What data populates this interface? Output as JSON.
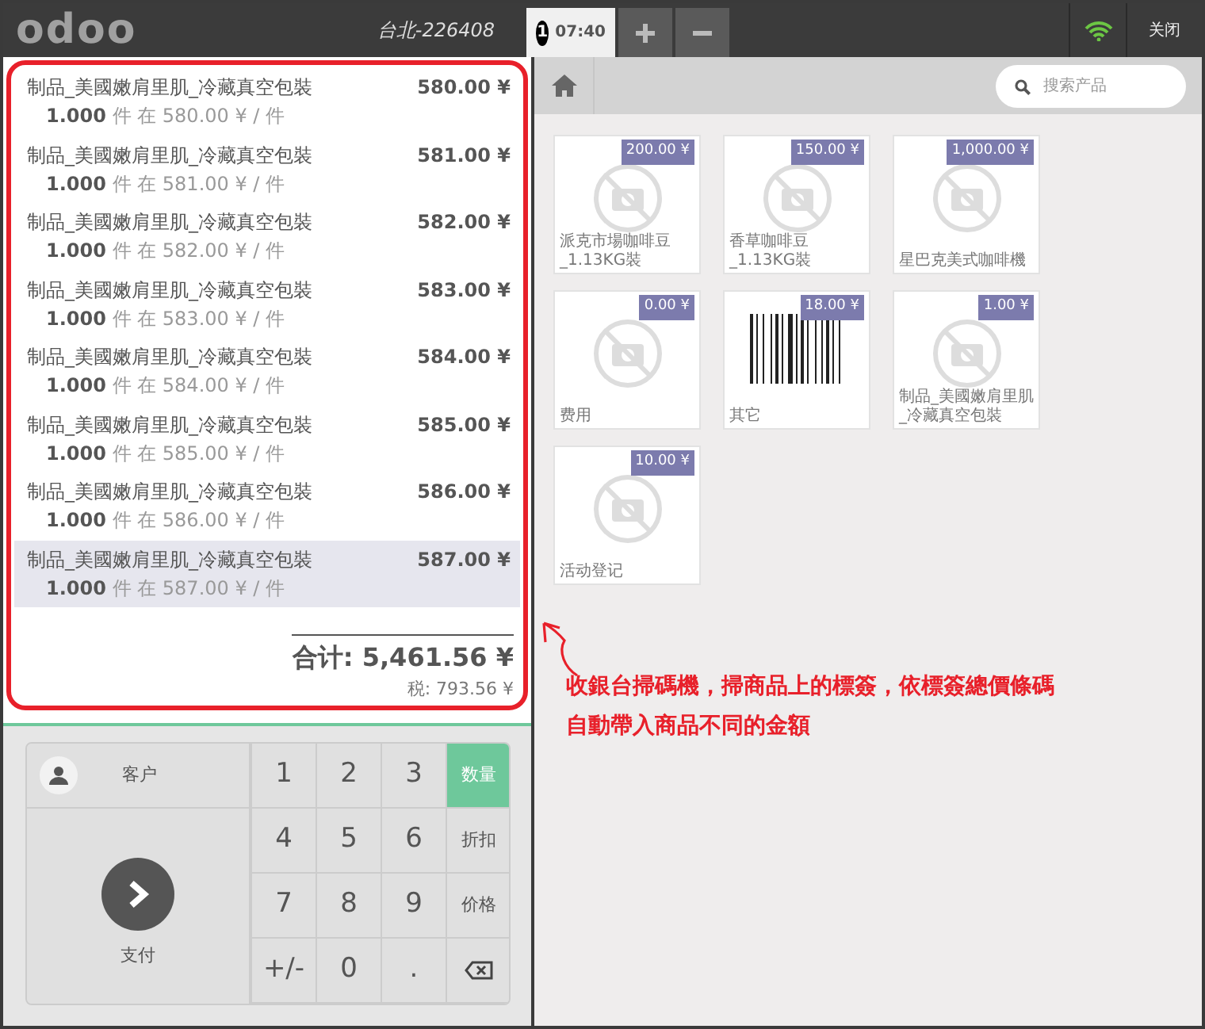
{
  "header": {
    "logo": "odoo",
    "shop": "台北-226408",
    "order_tabs": [
      {
        "number": "1",
        "time": "07:40",
        "selected": true
      }
    ],
    "close": "关闭"
  },
  "order_lines": [
    {
      "name": "制品_美國嫩肩里肌_冷藏真空包裝",
      "price": "580.00 ¥",
      "detail": "**1.000** 件 在 580.00 ¥ / 件",
      "selected": false
    },
    {
      "name": "制品_美國嫩肩里肌_冷藏真空包裝",
      "price": "581.00 ¥",
      "detail": "**1.000** 件 在 581.00 ¥ / 件",
      "selected": false
    },
    {
      "name": "制品_美國嫩肩里肌_冷藏真空包裝",
      "price": "582.00 ¥",
      "detail": "**1.000** 件 在 582.00 ¥ / 件",
      "selected": false
    },
    {
      "name": "制品_美國嫩肩里肌_冷藏真空包裝",
      "price": "583.00 ¥",
      "detail": "**1.000** 件 在 583.00 ¥ / 件",
      "selected": false
    },
    {
      "name": "制品_美國嫩肩里肌_冷藏真空包裝",
      "price": "584.00 ¥",
      "detail": "**1.000** 件 在 584.00 ¥ / 件",
      "selected": false
    },
    {
      "name": "制品_美國嫩肩里肌_冷藏真空包裝",
      "price": "585.00 ¥",
      "detail": "**1.000** 件 在 585.00 ¥ / 件",
      "selected": false
    },
    {
      "name": "制品_美國嫩肩里肌_冷藏真空包裝",
      "price": "586.00 ¥",
      "detail": "**1.000** 件 在 586.00 ¥ / 件",
      "selected": false
    },
    {
      "name": "制品_美國嫩肩里肌_冷藏真空包裝",
      "price": "587.00 ¥",
      "detail": "**1.000** 件 在 587.00 ¥ / 件",
      "selected": true
    }
  ],
  "total": "合计: 5,461.56 ¥",
  "tax": "税: 793.56 ¥",
  "numpad": {
    "customer": "客户",
    "pay": "支付",
    "keys": [
      {
        "kind": "digit",
        "label": "1"
      },
      {
        "kind": "digit",
        "label": "2"
      },
      {
        "kind": "digit",
        "label": "3"
      },
      {
        "kind": "mode",
        "label": "数量",
        "selected": true
      },
      {
        "kind": "digit",
        "label": "4"
      },
      {
        "kind": "digit",
        "label": "5"
      },
      {
        "kind": "digit",
        "label": "6"
      },
      {
        "kind": "mode",
        "label": "折扣",
        "selected": false
      },
      {
        "kind": "digit",
        "label": "7"
      },
      {
        "kind": "digit",
        "label": "8"
      },
      {
        "kind": "digit",
        "label": "9"
      },
      {
        "kind": "mode",
        "label": "价格",
        "selected": false
      },
      {
        "kind": "digit",
        "label": "+/-"
      },
      {
        "kind": "digit",
        "label": "0"
      },
      {
        "kind": "digit",
        "label": "."
      },
      {
        "kind": "backspace"
      }
    ]
  },
  "search": {
    "placeholder": "搜索产品"
  },
  "products": [
    {
      "name": "派克市場咖啡豆_1.13KG裝",
      "price": "200.00 ¥",
      "kind": "placeholder"
    },
    {
      "name": "香草咖啡豆_1.13KG裝",
      "price": "150.00 ¥",
      "kind": "placeholder"
    },
    {
      "name": "星巴克美式咖啡機",
      "price": "1,000.00 ¥",
      "kind": "placeholder"
    },
    {
      "name": "费用",
      "price": "0.00 ¥",
      "kind": "placeholder"
    },
    {
      "name": "其它",
      "price": "18.00 ¥",
      "kind": "barcode"
    },
    {
      "name": "制品_美國嫩肩里肌_冷藏真空包裝",
      "price": "1.00 ¥",
      "kind": "placeholder"
    },
    {
      "name": "活动登记",
      "price": "10.00 ¥",
      "kind": "placeholder"
    }
  ],
  "annotation": {
    "lines": [
      "收銀台掃碼機，掃商品上的標簽，依標簽總價條碼",
      "自動帶入商品不同的金額"
    ]
  }
}
